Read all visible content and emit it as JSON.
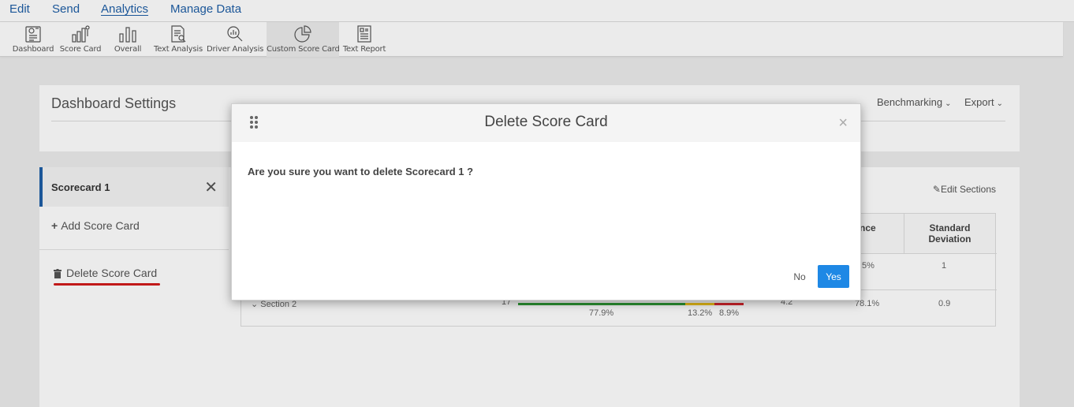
{
  "nav": {
    "items": [
      {
        "label": "Edit"
      },
      {
        "label": "Send"
      },
      {
        "label": "Analytics",
        "active": true
      },
      {
        "label": "Manage Data"
      }
    ]
  },
  "toolbar": {
    "items": [
      {
        "label": "Dashboard",
        "icon": "dashboard-icon"
      },
      {
        "label": "Score Card",
        "icon": "score-card-icon"
      },
      {
        "label": "Overall",
        "icon": "bar-chart-icon"
      },
      {
        "label": "Text Analysis",
        "icon": "text-analysis-icon"
      },
      {
        "label": "Driver Analysis",
        "icon": "driver-analysis-icon"
      },
      {
        "label": "Custom Score Card",
        "icon": "pie-chart-icon",
        "active": true
      },
      {
        "label": "Text Report",
        "icon": "text-report-icon"
      }
    ]
  },
  "settings": {
    "title": "Dashboard Settings",
    "benchmarking": "Benchmarking",
    "export": "Export"
  },
  "sidebar": {
    "scorecard_label": "Scorecard 1",
    "close_glyph": "✕",
    "add_label": "Add Score Card",
    "delete_label": "Delete Score Card"
  },
  "main": {
    "edit_sections": "Edit Sections",
    "headers": {
      "col_a": "nence",
      "col_b_line1": "Standard",
      "col_b_line2": "Deviation"
    },
    "rows": [
      {
        "pct": ".5%",
        "sd": "1"
      },
      {
        "section": "Section 2",
        "count": "17",
        "mean": "4.2",
        "pct": "78.1%",
        "sd": "0.9",
        "breakdown": {
          "green": "77.9%",
          "yellow": "13.2%",
          "red": "8.9%"
        }
      }
    ]
  },
  "modal": {
    "title": "Delete Score Card",
    "message": "Are you sure you want to delete Scorecard 1 ?",
    "no_label": "No",
    "yes_label": "Yes",
    "close_glyph": "×"
  },
  "colors": {
    "accent": "#1f5fa6",
    "primary_button": "#1e88e5",
    "highlight_red": "#d21c1c",
    "bar_green": "#2e9b35",
    "bar_yellow": "#f0c419",
    "bar_red": "#d9272e"
  }
}
